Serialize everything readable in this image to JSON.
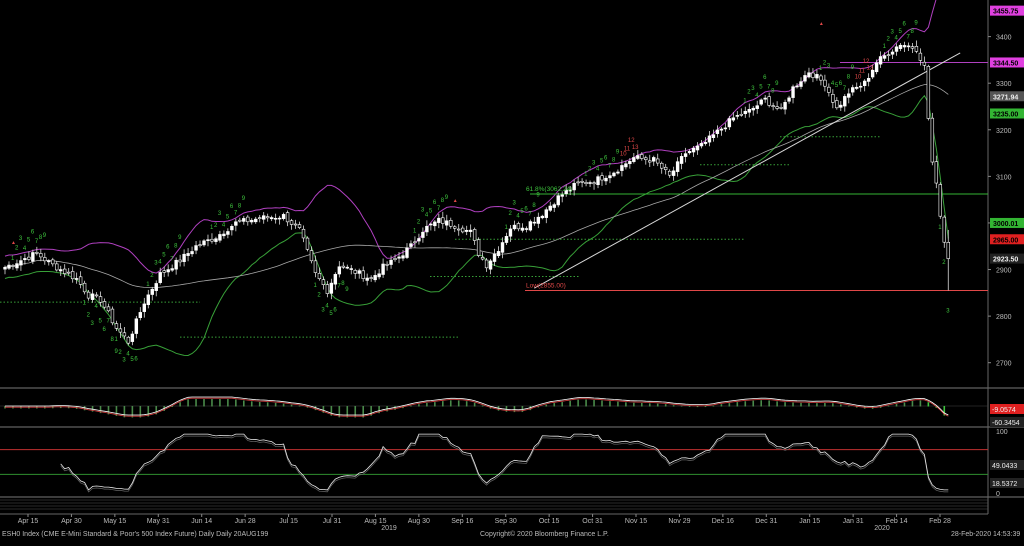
{
  "footer": {
    "left": "ESH0 Index (CME E-Mini Standard & Poor's 500 Index Future) Daily  Daily 20AUG199",
    "center": "Copyright© 2020 Bloomberg Finance L.P.",
    "right": "28-Feb-2020 14:53:39"
  },
  "colors": {
    "background": "#000000",
    "up_candle": "#ffffff",
    "bollinger": "#b040c0",
    "moving_average": "#a8a8a8",
    "lower_band": "#38a038",
    "trendline": "#d8d8d8",
    "seq_green": "#3ec43e",
    "seq_red": "#e04848",
    "tag_magenta": "#e040e0",
    "tag_green": "#33b533",
    "tag_red": "#e02020"
  },
  "chart_data": [
    {
      "type": "candlestick",
      "id": "price",
      "ylim": [
        2650,
        3470
      ],
      "y_ticks": [
        2700,
        2800,
        2900,
        3000,
        3100,
        3200,
        3300,
        3400
      ],
      "x_tick_labels": [
        "Apr 15",
        "Apr 30",
        "May 15",
        "May 31",
        "Jun 14",
        "Jun 28",
        "Jul 15",
        "Jul 31",
        "Aug 15",
        "Aug 30",
        "Sep 16",
        "Sep 30",
        "Oct 15",
        "Oct 31",
        "Nov 15",
        "Nov 29",
        "Dec 16",
        "Dec 31",
        "Jan 15",
        "Jan 31",
        "Feb 14",
        "Feb 28"
      ],
      "year_labels": [
        "2019",
        "2020"
      ],
      "close_anchors": [
        [
          0,
          2905
        ],
        [
          8,
          2935
        ],
        [
          11,
          2915
        ],
        [
          18,
          2880
        ],
        [
          21,
          2845
        ],
        [
          24,
          2835
        ],
        [
          28,
          2775
        ],
        [
          31,
          2745
        ],
        [
          35,
          2830
        ],
        [
          39,
          2890
        ],
        [
          44,
          2920
        ],
        [
          48,
          2950
        ],
        [
          53,
          2970
        ],
        [
          58,
          3000
        ],
        [
          64,
          3010
        ],
        [
          70,
          3015
        ],
        [
          74,
          2985
        ],
        [
          78,
          2890
        ],
        [
          81,
          2855
        ],
        [
          84,
          2910
        ],
        [
          88,
          2895
        ],
        [
          92,
          2880
        ],
        [
          95,
          2905
        ],
        [
          98,
          2920
        ],
        [
          102,
          2950
        ],
        [
          105,
          2985
        ],
        [
          109,
          3005
        ],
        [
          113,
          2995
        ],
        [
          117,
          2980
        ],
        [
          119,
          2935
        ],
        [
          121,
          2910
        ],
        [
          124,
          2945
        ],
        [
          127,
          2990
        ],
        [
          131,
          2995
        ],
        [
          135,
          3020
        ],
        [
          139,
          3055
        ],
        [
          144,
          3085
        ],
        [
          148,
          3090
        ],
        [
          153,
          3110
        ],
        [
          158,
          3140
        ],
        [
          163,
          3135
        ],
        [
          167,
          3100
        ],
        [
          171,
          3150
        ],
        [
          175,
          3165
        ],
        [
          179,
          3195
        ],
        [
          183,
          3225
        ],
        [
          187,
          3240
        ],
        [
          191,
          3265
        ],
        [
          195,
          3240
        ],
        [
          198,
          3290
        ],
        [
          202,
          3325
        ],
        [
          206,
          3300
        ],
        [
          209,
          3245
        ],
        [
          212,
          3280
        ],
        [
          216,
          3300
        ],
        [
          219,
          3345
        ],
        [
          222,
          3365
        ],
        [
          225,
          3385
        ],
        [
          227,
          3380
        ],
        [
          229,
          3375
        ],
        [
          231,
          3335
        ],
        [
          232,
          3225
        ],
        [
          233,
          3130
        ],
        [
          234,
          3080
        ],
        [
          235,
          3020
        ],
        [
          236,
          2960
        ],
        [
          237,
          2923.5
        ]
      ],
      "price_tags": [
        {
          "value": 3455.75,
          "label": "3455.75",
          "color": "#e040e0"
        },
        {
          "value": 3344.5,
          "label": "3344.50",
          "color": "#e040e0"
        },
        {
          "value": 3271.94,
          "label": "3271.94",
          "color": "#555555"
        },
        {
          "value": 3235.0,
          "label": "3235.00",
          "color": "#33b533"
        },
        {
          "value": 3000.01,
          "label": "3000.01",
          "color": "#33b533"
        },
        {
          "value": 2965.0,
          "label": "2965.00",
          "color": "#e02020"
        },
        {
          "value": 2923.5,
          "label": "2923.50",
          "color": "#222222"
        }
      ],
      "annotations": [
        {
          "text": "61.8%(3062.24)",
          "value": 3062.24,
          "color": "#3ec43e"
        },
        {
          "text": "Low(2855.00)",
          "value": 2855.0,
          "color": "#e04848"
        }
      ],
      "horizontal_levels": [
        {
          "value": 3062.24,
          "color": "#33b533"
        },
        {
          "value": 2855.0,
          "color": "#e04848"
        },
        {
          "value": 3344.5,
          "color": "#b040c0"
        }
      ],
      "trendline": {
        "from": [
          133,
          2860
        ],
        "to": [
          240,
          3365
        ]
      },
      "seq_labels": [
        "1",
        "2",
        "3",
        "4",
        "5",
        "6",
        "7",
        "8",
        "9",
        "10",
        "11",
        "12",
        "13"
      ]
    },
    {
      "type": "line",
      "id": "macd",
      "series_tags": [
        {
          "label": "-9.0574",
          "color": "#e02020"
        },
        {
          "label": "-60.3454",
          "color": "#222222"
        }
      ]
    },
    {
      "type": "line",
      "id": "rsi",
      "ylim": [
        0,
        100
      ],
      "y_ticks": [
        0,
        100
      ],
      "levels": [
        70,
        30
      ],
      "series_tags": [
        {
          "label": "49.0433",
          "color": "#222222"
        },
        {
          "label": "18.5372",
          "color": "#222222"
        }
      ]
    }
  ]
}
